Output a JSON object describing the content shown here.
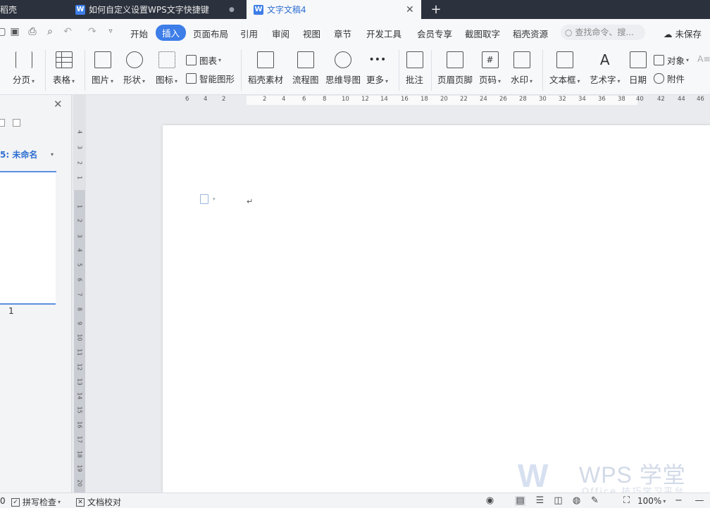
{
  "tabs": [
    {
      "label": "稻壳"
    },
    {
      "label": "如何自定义设置WPS文字快捷键",
      "dirty_marker": "●"
    },
    {
      "label": "文字文稿4",
      "close": "✕"
    }
  ],
  "new_tab": "+",
  "menu": {
    "items": [
      "开始",
      "插入",
      "页面布局",
      "引用",
      "审阅",
      "视图",
      "章节",
      "开发工具",
      "会员专享",
      "截图取字",
      "稻壳资源"
    ],
    "active": "插入",
    "search_placeholder": "查找命令、搜...",
    "unsaved": "未保存"
  },
  "ribbon": {
    "page_break": "分页",
    "table": "表格",
    "picture": "图片",
    "shape": "形状",
    "icon": "图标",
    "chart": "图表",
    "smart_graphic": "智能图形",
    "docer_material": "稻壳素材",
    "flowchart": "流程图",
    "mindmap": "思维导图",
    "more": "更多",
    "comment": "批注",
    "header_footer": "页眉页脚",
    "page_number": "页码",
    "watermark": "水印",
    "textbox": "文本框",
    "wordart": "艺术字",
    "date": "日期",
    "object": "对象",
    "attachment": "附件"
  },
  "left_panel": {
    "title": "5: 未命名",
    "page_number": "1"
  },
  "hruler_ticks": [
    "6",
    "4",
    "2",
    "2",
    "4",
    "6",
    "8",
    "10",
    "12",
    "14",
    "16",
    "18",
    "20",
    "22",
    "24",
    "26",
    "28",
    "30",
    "32",
    "34",
    "36",
    "38",
    "40",
    "42",
    "44",
    "46"
  ],
  "vruler_ticks": [
    "4",
    "3",
    "2",
    "1",
    "1",
    "2",
    "3",
    "4",
    "5",
    "6",
    "7",
    "8",
    "9",
    "10",
    "11",
    "12",
    "13",
    "14",
    "15",
    "16",
    "17",
    "18",
    "19",
    "20"
  ],
  "paragraph_mark": "↵",
  "watermark": {
    "logo": "W",
    "brand": "WPS 学堂",
    "sub": "Office 技巧学习平台"
  },
  "status": {
    "left_value": "0",
    "spell_check": "拼写检查",
    "doc_proof": "文档校对",
    "zoom": "100%"
  }
}
